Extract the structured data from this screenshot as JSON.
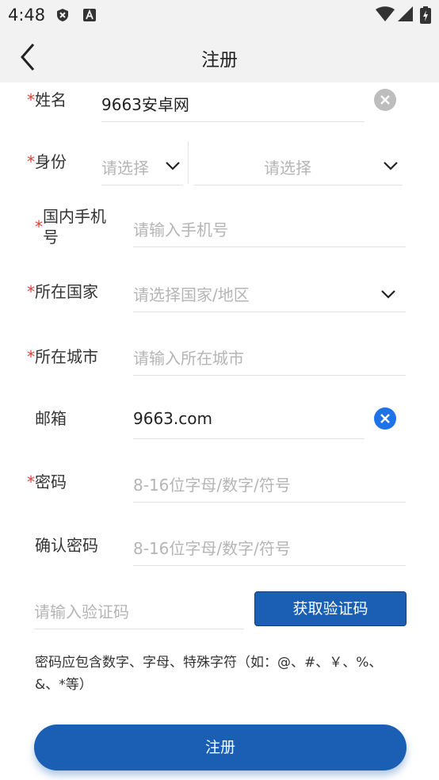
{
  "status_bar": {
    "time": "4:48"
  },
  "header": {
    "title": "注册"
  },
  "required_mark": "*",
  "form": {
    "name": {
      "label": "姓名",
      "value": "9663安卓网"
    },
    "identity": {
      "label": "身份",
      "placeholder_1": "请选择",
      "placeholder_2": "请选择"
    },
    "phone": {
      "label_line1": "国内手机",
      "label_line2": "号",
      "placeholder": "请输入手机号"
    },
    "country": {
      "label": "所在国家",
      "placeholder": "请选择国家/地区"
    },
    "city": {
      "label": "所在城市",
      "placeholder": "请输入所在城市"
    },
    "email": {
      "label": "邮箱",
      "value": "9663.com"
    },
    "password": {
      "label": "密码",
      "placeholder": "8-16位字母/数字/符号"
    },
    "confirm_password": {
      "label": "确认密码",
      "placeholder": "8-16位字母/数字/符号"
    },
    "verification": {
      "placeholder": "请输入验证码",
      "button_label": "获取验证码"
    }
  },
  "hint": "密码应包含数字、字母、特殊字符（如：@、#、￥、%、&、*等）",
  "submit_label": "注册",
  "colors": {
    "accent": "#1a5fb4",
    "required": "#e53935",
    "placeholder": "#b5b5b5",
    "clear_gray": "#bdbdbd",
    "clear_blue": "#1e73e8"
  }
}
